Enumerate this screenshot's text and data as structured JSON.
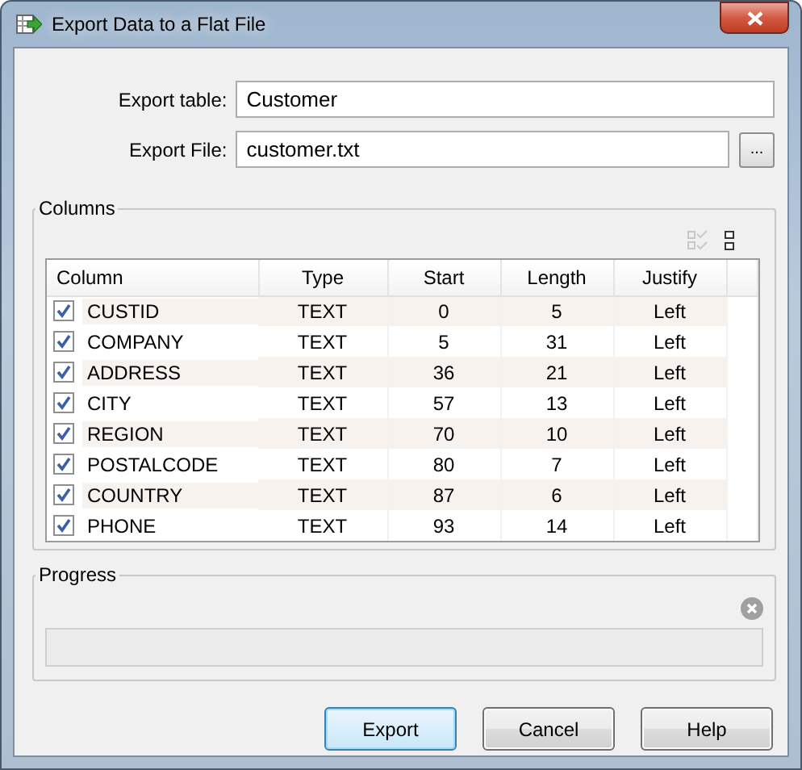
{
  "window": {
    "title": "Export Data to a Flat File"
  },
  "fields": [
    {
      "label": "Export table:",
      "value": "Customer"
    },
    {
      "label": "Export File:",
      "value": "customer.txt",
      "browse_label": "..."
    }
  ],
  "columns_group": {
    "title": "Columns",
    "table": {
      "columns": [
        "Column",
        "Type",
        "Start",
        "Length",
        "Justify"
      ],
      "rows": [
        {
          "checked": true,
          "column": "CUSTID",
          "type": "TEXT",
          "start": "0",
          "length": "5",
          "justify": "Left"
        },
        {
          "checked": true,
          "column": "COMPANY",
          "type": "TEXT",
          "start": "5",
          "length": "31",
          "justify": "Left"
        },
        {
          "checked": true,
          "column": "ADDRESS",
          "type": "TEXT",
          "start": "36",
          "length": "21",
          "justify": "Left"
        },
        {
          "checked": true,
          "column": "CITY",
          "type": "TEXT",
          "start": "57",
          "length": "13",
          "justify": "Left"
        },
        {
          "checked": true,
          "column": "REGION",
          "type": "TEXT",
          "start": "70",
          "length": "10",
          "justify": "Left"
        },
        {
          "checked": true,
          "column": "POSTALCODE",
          "type": "TEXT",
          "start": "80",
          "length": "7",
          "justify": "Left"
        },
        {
          "checked": true,
          "column": "COUNTRY",
          "type": "TEXT",
          "start": "87",
          "length": "6",
          "justify": "Left"
        },
        {
          "checked": true,
          "column": "PHONE",
          "type": "TEXT",
          "start": "93",
          "length": "14",
          "justify": "Left"
        }
      ]
    }
  },
  "progress_group": {
    "title": "Progress",
    "level": 0
  },
  "buttons": [
    {
      "label": "Export",
      "default": true
    },
    {
      "label": "Cancel",
      "default": false
    },
    {
      "label": "Help",
      "default": false
    }
  ]
}
